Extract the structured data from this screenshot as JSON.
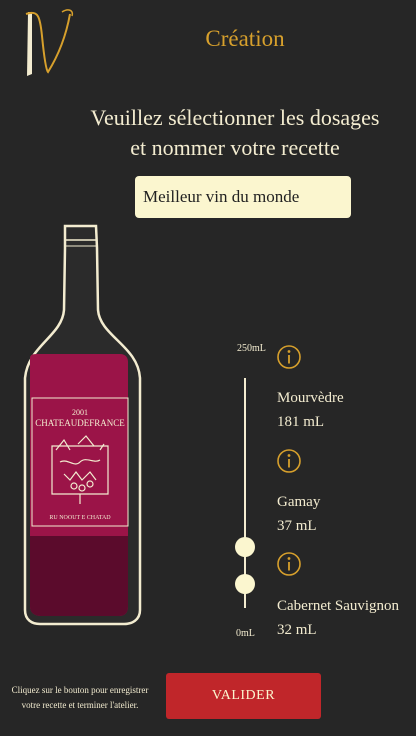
{
  "header": {
    "logo_text": "V",
    "title": "Création"
  },
  "form": {
    "prompt_line1": "Veuillez sélectionner les dosages",
    "prompt_line2": "et nommer votre recette",
    "recipe_name": "Meilleur vin du monde"
  },
  "bottle": {
    "label_year": "2001",
    "label_name": "CHATEAUDEFRANCE",
    "label_bottom": "RU NOOUT E CHATAD",
    "wine_color": "#9b1448"
  },
  "dosage": {
    "scale_max": "250mL",
    "scale_min": "0mL",
    "grapes": [
      {
        "name": "Mourvèdre",
        "amount": "181 mL"
      },
      {
        "name": "Gamay",
        "amount": "37 mL"
      },
      {
        "name": "Cabernet Sauvignon",
        "amount": "32 mL"
      }
    ],
    "slider_levels_ml": [
      69,
      32
    ]
  },
  "footer": {
    "hint_line1": "Cliquez sur le bouton pour enregistrer",
    "hint_line2": "votre recette et terminer l'atelier.",
    "submit_label": "VALIDER"
  },
  "colors": {
    "accent": "#d7a02c",
    "background": "#262626",
    "button": "#c0262a",
    "cream": "#f3ecd0"
  }
}
